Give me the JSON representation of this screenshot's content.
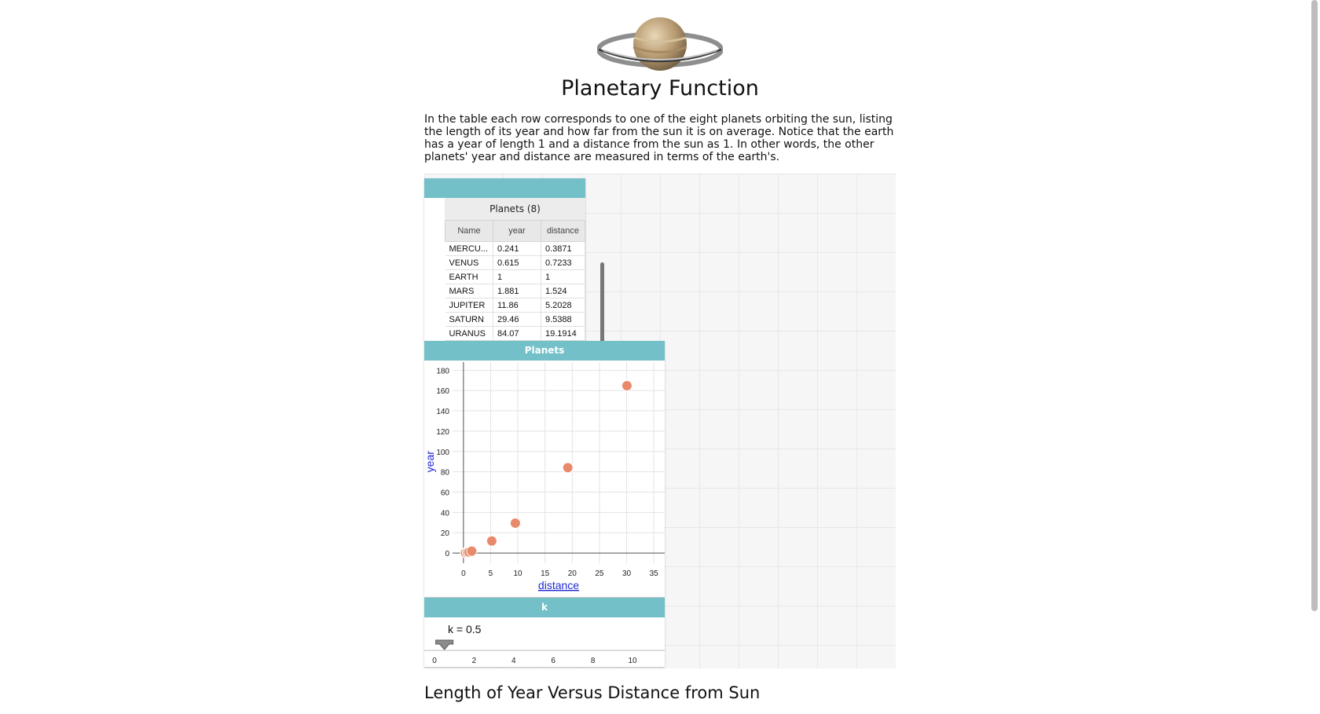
{
  "page": {
    "title": "Planetary Function",
    "intro": "In the table each row corresponds to one of the eight planets orbiting the sun, listing the length of its year and how far from the sun it is on average. Notice that the earth has a year of length 1 and a distance from the sun as 1. In other words, the other planets' year and distance are measured in terms of the earth's.",
    "section_heading": "Length of Year Versus Distance from Sun",
    "logo_icon": "saturn-icon"
  },
  "table_tile": {
    "caption": "Planets (8)",
    "columns": [
      "Name",
      "year",
      "distance"
    ],
    "rows": [
      [
        "MERCU...",
        "0.241",
        "0.3871"
      ],
      [
        "VENUS",
        "0.615",
        "0.7233"
      ],
      [
        "EARTH",
        "1",
        "1"
      ],
      [
        "MARS",
        "1.881",
        "1.524"
      ],
      [
        "JUPITER",
        "11.86",
        "5.2028"
      ],
      [
        "SATURN",
        "29.46",
        "9.5388"
      ],
      [
        "URANUS",
        "84.07",
        "19.1914"
      ]
    ]
  },
  "graph_tile": {
    "title": "Planets"
  },
  "slider_tile": {
    "title": "k",
    "value_label": "k = 0.5",
    "value": 0.5,
    "ticks": [
      "0",
      "2",
      "4",
      "6",
      "8",
      "10"
    ]
  },
  "colors": {
    "tile_header": "#74c0c8",
    "point": "#e9896b",
    "axis_label": "#1f2ad6"
  },
  "chart_data": {
    "type": "scatter",
    "title": "Planets",
    "xlabel": "distance",
    "ylabel": "year",
    "xlim": [
      -2,
      37
    ],
    "ylim": [
      -10,
      188
    ],
    "xticks": [
      0,
      5,
      10,
      15,
      20,
      25,
      30,
      35
    ],
    "yticks": [
      0,
      20,
      40,
      60,
      80,
      100,
      120,
      140,
      160,
      180
    ],
    "grid": true,
    "points": [
      {
        "x": 0.3871,
        "y": 0.241
      },
      {
        "x": 0.7233,
        "y": 0.615
      },
      {
        "x": 1,
        "y": 1
      },
      {
        "x": 1.524,
        "y": 1.881
      },
      {
        "x": 5.2028,
        "y": 11.86
      },
      {
        "x": 9.5388,
        "y": 29.46
      },
      {
        "x": 19.1914,
        "y": 84.07
      },
      {
        "x": 30.06,
        "y": 164.8
      }
    ]
  }
}
